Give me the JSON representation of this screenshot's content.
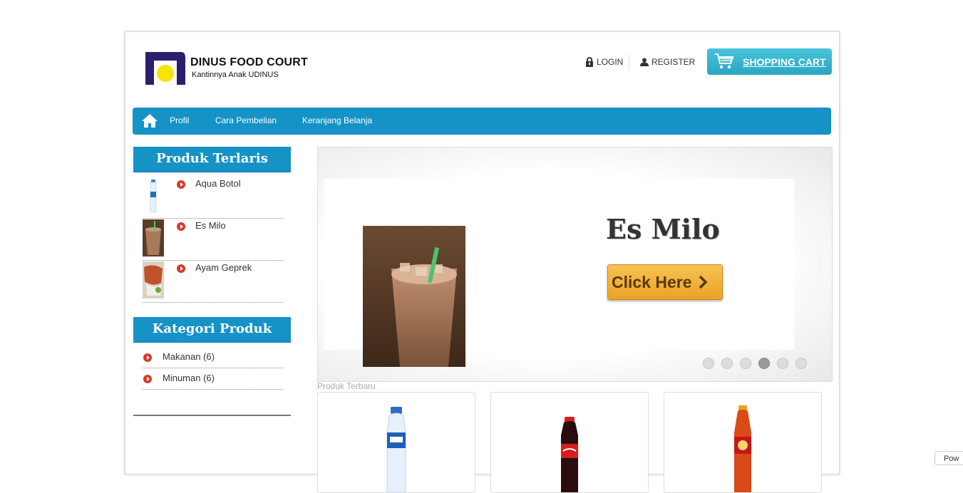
{
  "brand": {
    "title": "DINUS FOOD COURT",
    "subtitle": "Kantinnya Anak UDINUS",
    "logo_icon": "dinus-logo"
  },
  "header": {
    "login_label": "LOGIN",
    "register_label": "REGISTER",
    "cart_label": "SHOPPING CART",
    "cart_color": "#2aa6c2"
  },
  "nav": {
    "home_icon": "home-icon",
    "items": [
      {
        "label": "Profil"
      },
      {
        "label": "Cara Pembelian"
      },
      {
        "label": "Keranjang Belanja"
      }
    ],
    "color": "#1592c6"
  },
  "sidebar": {
    "best_title": "Produk Terlaris",
    "best_items": [
      {
        "name": "Aqua Botol"
      },
      {
        "name": "Es Milo"
      },
      {
        "name": "Ayam Geprek"
      }
    ],
    "category_title": "Kategori Produk",
    "categories": [
      {
        "name": "Makanan (6)"
      },
      {
        "name": "Minuman (6)"
      }
    ]
  },
  "slider": {
    "title": "Es Milo",
    "button_label": "Click Here",
    "button_icon": "chevron-right-icon",
    "slide_count": 6,
    "active_slide": 4
  },
  "newest": {
    "label": "Produk Terbaru",
    "products": [
      {
        "icon": "aqua-bottle"
      },
      {
        "icon": "coca-cola-bottle"
      },
      {
        "icon": "fanta-bottle"
      }
    ]
  },
  "corner": {
    "label": "Pow"
  }
}
